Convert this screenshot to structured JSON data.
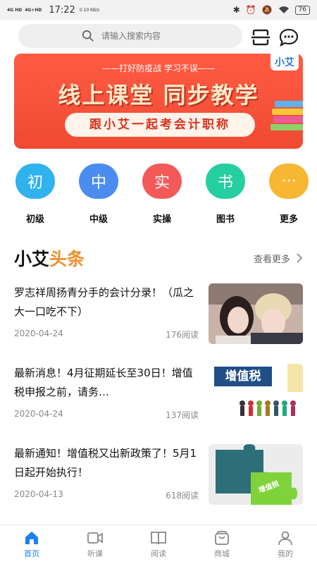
{
  "status_bar": {
    "network1": "4G HD",
    "network2": "4G+HD",
    "time": "17:22",
    "speed": "0.10 KB/s",
    "battery": "76"
  },
  "search": {
    "placeholder": "请输入搜索内容"
  },
  "banner": {
    "subtitle": "——打好防疫战 学习不误——",
    "headline": "线上课堂 同步教学",
    "tagline": "跟小艾一起考会计职称",
    "brand": "小艾"
  },
  "categories": [
    {
      "glyph": "初",
      "label": "初级",
      "color": "#2fb2ee"
    },
    {
      "glyph": "中",
      "label": "中级",
      "color": "#4b8cf0"
    },
    {
      "glyph": "实",
      "label": "实操",
      "color": "#f25a5a"
    },
    {
      "glyph": "书",
      "label": "图书",
      "color": "#25cfa0"
    },
    {
      "glyph": "···",
      "label": "更多",
      "color": "#f7b733"
    }
  ],
  "news": {
    "title_part1": "小艾",
    "title_part2": "头条",
    "more_label": "查看更多",
    "items": [
      {
        "title": "罗志祥周扬青分手的会计分录！（瓜之大一口吃不下）",
        "date": "2020-04-24",
        "reads": "176阅读"
      },
      {
        "title": "最新消息！4月征期延长至30日！增值税申报之前，请务…",
        "date": "2020-04-24",
        "reads": "137阅读",
        "thumb_text": "增值税"
      },
      {
        "title": "最新通知！增值税又出新政策了！5月1日起开始执行！",
        "date": "2020-04-13",
        "reads": "618阅读",
        "thumb_text": "增值税"
      }
    ]
  },
  "tabs": [
    {
      "label": "首页",
      "icon": "home-icon",
      "active": true
    },
    {
      "label": "听课",
      "icon": "video-icon"
    },
    {
      "label": "阅读",
      "icon": "book-icon"
    },
    {
      "label": "商城",
      "icon": "shop-bag-icon"
    },
    {
      "label": "我的",
      "icon": "person-icon"
    }
  ],
  "colors": {
    "accent": "#1e7ff2",
    "news_accent": "#f0902c",
    "banner_red": "#f04a33"
  }
}
